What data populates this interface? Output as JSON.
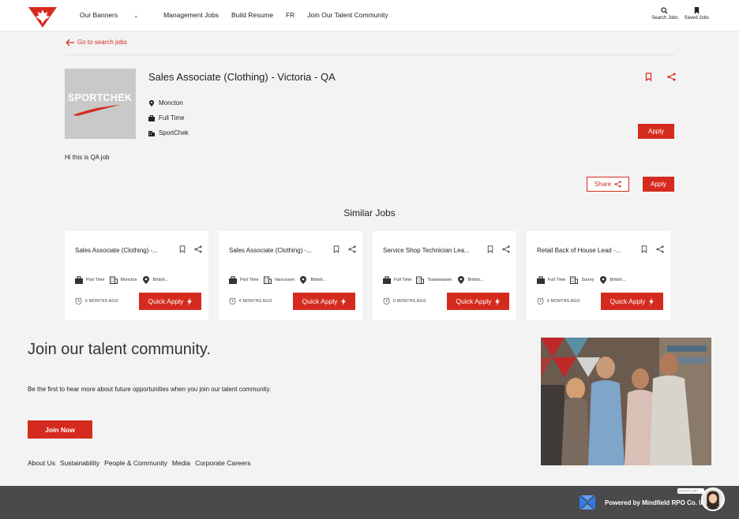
{
  "header": {
    "nav": [
      "Our Banners",
      "Management Jobs",
      "Build Resume",
      "FR",
      "Join Our Talent Community"
    ],
    "search_label": "Search Jobs",
    "saved_label": "Saved Jobs"
  },
  "back_link": "Go to search jobs",
  "job": {
    "title": "Sales Associate (Clothing) - Victoria - QA",
    "banner_logo_text": "SPORTCHEK",
    "location": "Moncton",
    "type": "Full Time",
    "banner": "SportChek",
    "description": "Hi this is QA job",
    "apply_label": "Apply",
    "share_label": "Share"
  },
  "similar_title": "Similar Jobs",
  "similar_jobs": [
    {
      "title": "Sales Associate (Clothing) -...",
      "type": "Part Time",
      "city": "Moncton",
      "province": "British...",
      "ago": "6 MONTHS AGO",
      "button": "Quick Apply"
    },
    {
      "title": "Sales Associate (Clothing) -...",
      "type": "Part Time",
      "city": "Vancouver",
      "province": "British...",
      "ago": "6 MONTHS AGO",
      "button": "Quick Apply"
    },
    {
      "title": "Service Shop Technician Lea...",
      "type": "Full Time",
      "city": "Tsawwassen",
      "province": "British...",
      "ago": "6 MONTHS AGO",
      "button": "Quick Apply"
    },
    {
      "title": "Retail Back of House Lead -...",
      "type": "Full Time",
      "city": "Surrey",
      "province": "British...",
      "ago": "6 MONTHS AGO",
      "button": "Quick Apply"
    }
  ],
  "talent": {
    "title": "Join our talent community.",
    "subtitle": "Be the first to hear more about future opportunities when you join our talent community.",
    "button": "Join Now"
  },
  "footer_links": [
    "About Us",
    "Sustainability",
    "People & Community",
    "Media",
    "Corporate Careers"
  ],
  "bottom_bar": {
    "powered": "Powered by Mindfield RPO Co. Inc.",
    "chat_tip": "Looking for a job?"
  },
  "colors": {
    "accent": "#d52b1e",
    "footer": "#4a4a4c",
    "background": "#f3f3f3"
  }
}
